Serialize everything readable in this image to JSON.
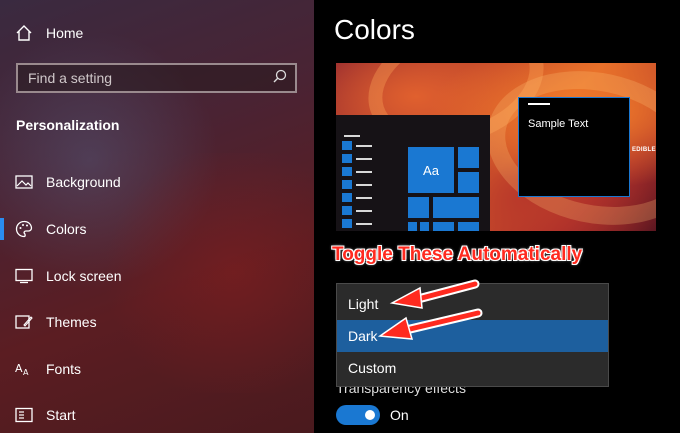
{
  "sidebar": {
    "home": {
      "label": "Home",
      "icon": "home-icon"
    },
    "search": {
      "placeholder": "Find a setting",
      "icon": "search-icon"
    },
    "section_title": "Personalization",
    "items": [
      {
        "label": "Background",
        "icon": "image-icon"
      },
      {
        "label": "Colors",
        "icon": "palette-icon",
        "active": true
      },
      {
        "label": "Lock screen",
        "icon": "lock-screen-icon"
      },
      {
        "label": "Themes",
        "icon": "themes-icon"
      },
      {
        "label": "Fonts",
        "icon": "fonts-icon"
      },
      {
        "label": "Start",
        "icon": "start-icon"
      }
    ]
  },
  "main": {
    "title": "Colors",
    "preview": {
      "sample_text": "Sample Text",
      "tile_label": "Aa",
      "wallpaper_text": "EDIBLE"
    },
    "annotation": "Toggle These Automatically",
    "mode_options": [
      {
        "label": "Light",
        "selected": false
      },
      {
        "label": "Dark",
        "selected": true
      },
      {
        "label": "Custom",
        "selected": false
      }
    ],
    "transparency": {
      "label": "Transparency effects",
      "state": "On",
      "enabled": true
    }
  },
  "colors": {
    "accent": "#1a78d2",
    "selected_option": "#1d5f9e",
    "annotation_red": "#ff2a1f",
    "background": "#000000"
  }
}
